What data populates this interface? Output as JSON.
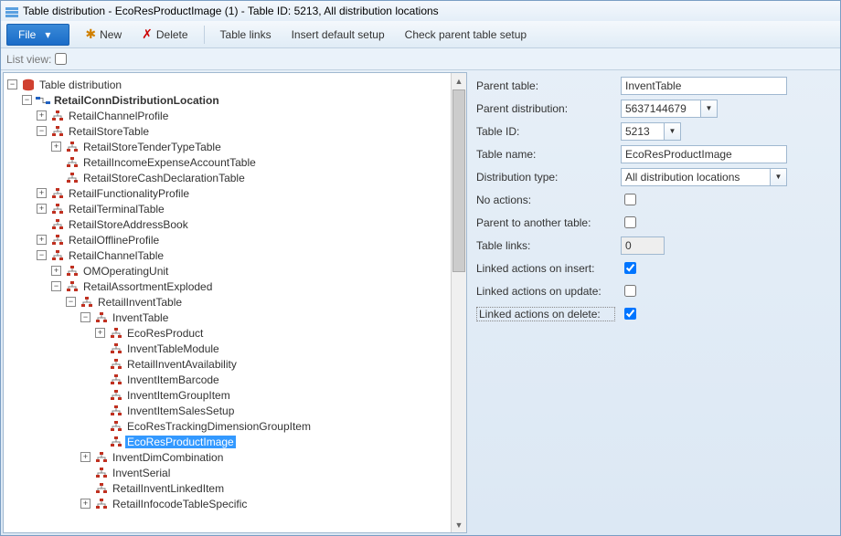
{
  "titlebar": {
    "title": "Table distribution - EcoResProductImage (1) - Table ID: 5213, All distribution locations"
  },
  "toolbar": {
    "file": "File",
    "new": "New",
    "delete": "Delete",
    "table_links": "Table links",
    "insert_default": "Insert default setup",
    "check_parent": "Check parent table setup"
  },
  "subbar": {
    "list_view_label": "List view:"
  },
  "tree": {
    "root": "Table distribution",
    "n0": "RetailConnDistributionLocation",
    "n1": "RetailChannelProfile",
    "n2": "RetailStoreTable",
    "n2a": "RetailStoreTenderTypeTable",
    "n2b": "RetailIncomeExpenseAccountTable",
    "n2c": "RetailStoreCashDeclarationTable",
    "n3": "RetailFunctionalityProfile",
    "n4": "RetailTerminalTable",
    "n5": "RetailStoreAddressBook",
    "n6": "RetailOfflineProfile",
    "n7": "RetailChannelTable",
    "n7a": "OMOperatingUnit",
    "n7b": "RetailAssortmentExploded",
    "n7b1": "RetailInventTable",
    "n7b1a": "InventTable",
    "n7b1a1": "EcoResProduct",
    "n7b1a2": "InventTableModule",
    "n7b1a3": "RetailInventAvailability",
    "n7b1a4": "InventItemBarcode",
    "n7b1a5": "InventItemGroupItem",
    "n7b1a6": "InventItemSalesSetup",
    "n7b1a7": "EcoResTrackingDimensionGroupItem",
    "n7b1a8": "EcoResProductImage",
    "n7b1b": "InventDimCombination",
    "n7b1c": "InventSerial",
    "n7b1d": "RetailInventLinkedItem",
    "n7b1e": "RetailInfocodeTableSpecific"
  },
  "props": {
    "parent_table_label": "Parent table:",
    "parent_table": "InventTable",
    "parent_dist_label": "Parent distribution:",
    "parent_dist": "5637144679",
    "table_id_label": "Table ID:",
    "table_id": "5213",
    "table_name_label": "Table name:",
    "table_name": "EcoResProductImage",
    "dist_type_label": "Distribution type:",
    "dist_type": "All distribution locations",
    "no_actions_label": "No actions:",
    "parent_another_label": "Parent to another table:",
    "table_links_label": "Table links:",
    "table_links": "0",
    "linked_insert_label": "Linked actions on insert:",
    "linked_update_label": "Linked actions on update:",
    "linked_delete_label": "Linked actions on delete:"
  }
}
